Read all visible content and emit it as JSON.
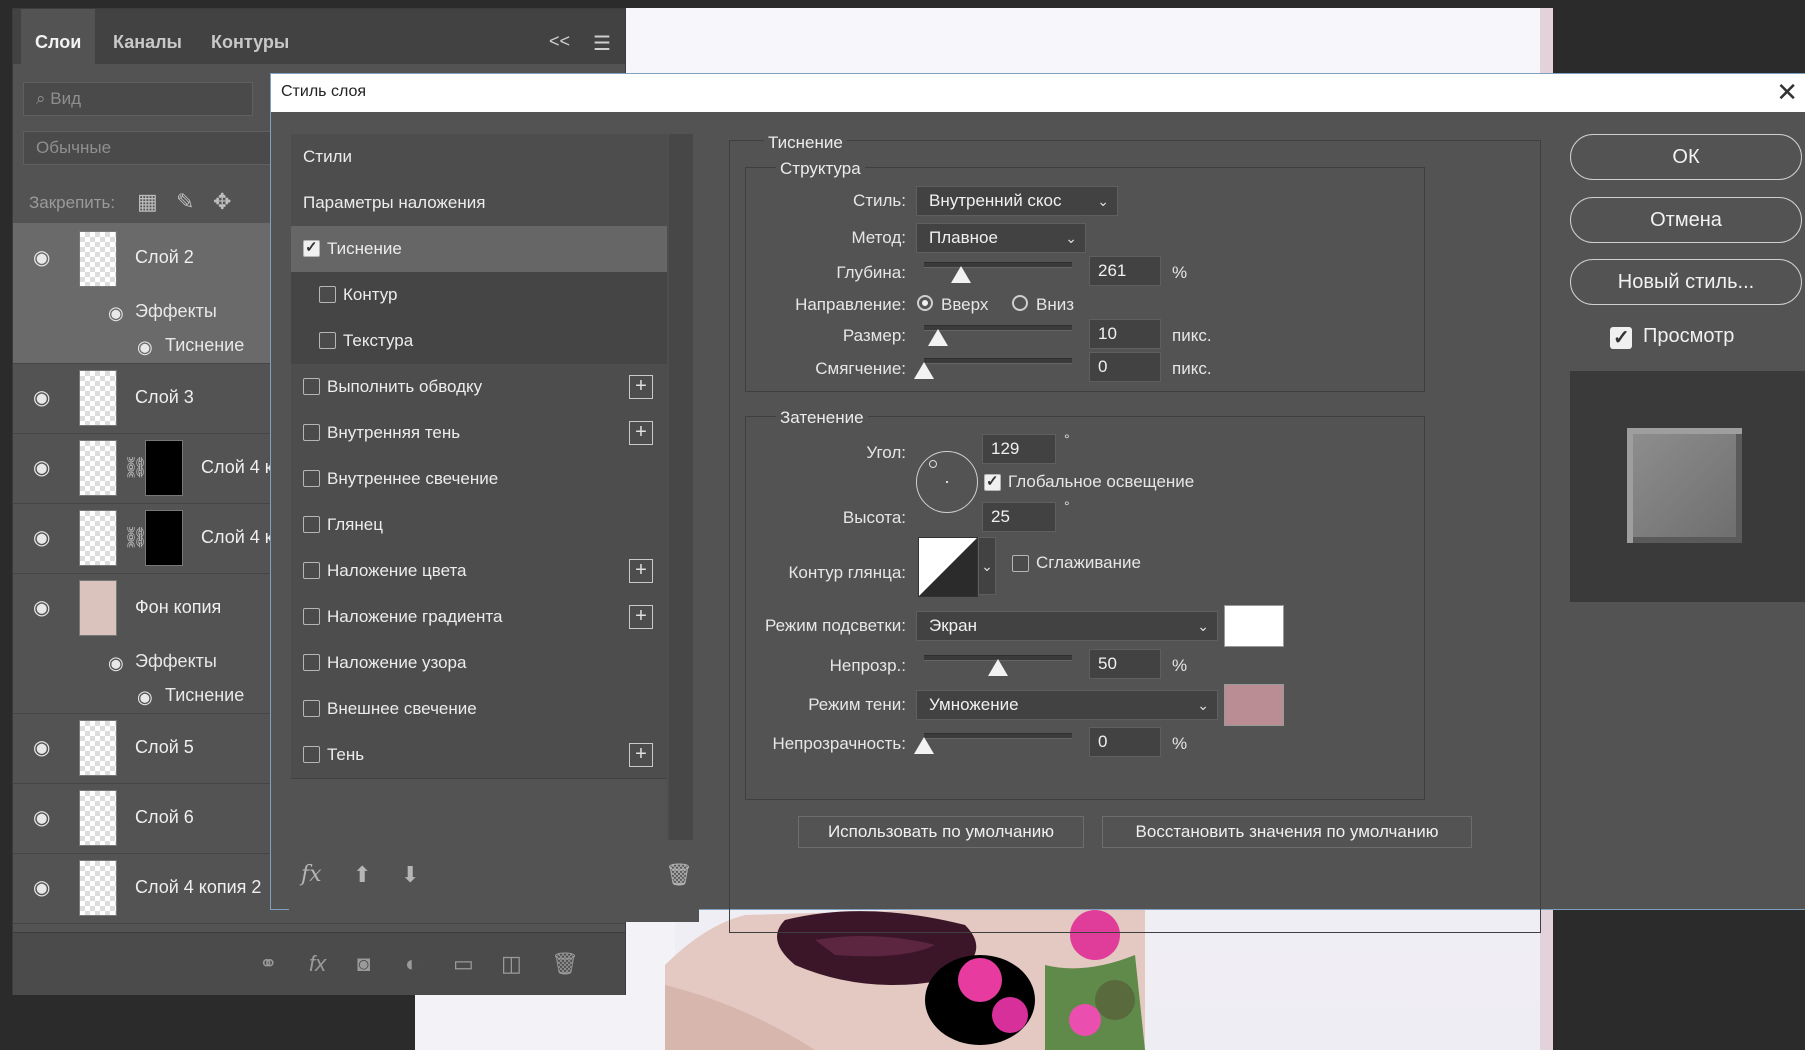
{
  "layers_panel": {
    "tabs": [
      "Слои",
      "Каналы",
      "Контуры"
    ],
    "collapse_glyph": "<<",
    "filter_placeholder": "Вид",
    "blend_mode": "Обычные",
    "lock_label": "Закрепить:",
    "layers": [
      {
        "name": "Слой 2",
        "effects_label": "Эффекты",
        "effect": "Тиснение",
        "selected": true
      },
      {
        "name": "Слой 3"
      },
      {
        "name": "Слой 4 к"
      },
      {
        "name": "Слой 4 к"
      },
      {
        "name": "Фон копия",
        "effects_label": "Эффекты",
        "effect": "Тиснение"
      },
      {
        "name": "Слой 5"
      },
      {
        "name": "Слой 6"
      },
      {
        "name": "Слой 4 копия 2"
      }
    ]
  },
  "dialog": {
    "title": "Стиль слоя",
    "styles_header": "Стили",
    "blending_options": "Параметры наложения",
    "style_items": [
      {
        "label": "Тиснение",
        "checked": true,
        "active": true
      },
      {
        "label": "Контур",
        "checked": false,
        "sub": true
      },
      {
        "label": "Текстура",
        "checked": false,
        "sub": true
      },
      {
        "label": "Выполнить обводку",
        "checked": false,
        "plus": true
      },
      {
        "label": "Внутренняя тень",
        "checked": false,
        "plus": true
      },
      {
        "label": "Внутреннее свечение",
        "checked": false
      },
      {
        "label": "Глянец",
        "checked": false
      },
      {
        "label": "Наложение цвета",
        "checked": false,
        "plus": true
      },
      {
        "label": "Наложение градиента",
        "checked": false,
        "plus": true
      },
      {
        "label": "Наложение узора",
        "checked": false
      },
      {
        "label": "Внешнее свечение",
        "checked": false
      },
      {
        "label": "Тень",
        "checked": false,
        "plus": true
      }
    ],
    "fx_label": "fx",
    "settings": {
      "group_title": "Тиснение",
      "structure_title": "Структура",
      "style_label": "Стиль:",
      "style_value": "Внутренний скос",
      "method_label": "Метод:",
      "method_value": "Плавное",
      "depth_label": "Глубина:",
      "depth_value": "261",
      "depth_unit": "%",
      "direction_label": "Направление:",
      "direction_up": "Вверх",
      "direction_down": "Вниз",
      "size_label": "Размер:",
      "size_value": "10",
      "size_unit": "пикс.",
      "soften_label": "Смягчение:",
      "soften_value": "0",
      "soften_unit": "пикс.",
      "shading_title": "Затенение",
      "angle_label": "Угол:",
      "angle_value": "129",
      "degree": "°",
      "global_light": "Глобальное освещение",
      "altitude_label": "Высота:",
      "altitude_value": "25",
      "gloss_label": "Контур глянца:",
      "antialias": "Сглаживание",
      "highlight_label": "Режим подсветки:",
      "highlight_value": "Экран",
      "highlight_color": "#ffffff",
      "opacity_label": "Непрозр.:",
      "opacity_value": "50",
      "opacity_unit": "%",
      "shadow_label": "Режим тени:",
      "shadow_value": "Умножение",
      "shadow_color": "#b98d93",
      "shadow_opacity_label": "Непрозрачность:",
      "shadow_opacity_value": "0",
      "shadow_opacity_unit": "%",
      "make_default": "Использовать по умолчанию",
      "reset_default": "Восстановить значения по умолчанию"
    },
    "buttons": {
      "ok": "ОК",
      "cancel": "Отмена",
      "new_style": "Новый стиль...",
      "preview": "Просмотр"
    }
  }
}
